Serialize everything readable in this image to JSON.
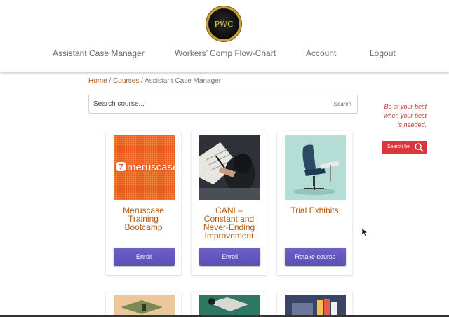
{
  "header": {
    "logo_text": "PWC",
    "nav": [
      "Assistant Case Manager",
      "Workers’ Comp Flow-Chart",
      "Account",
      "Logout"
    ]
  },
  "breadcrumb": {
    "home": "Home",
    "sep1": " / ",
    "courses": "Courses",
    "sep2": " / ",
    "current": "Assistant Case Manager"
  },
  "search": {
    "placeholder": "Search course...",
    "button": "Search"
  },
  "sidebar": {
    "tagline": [
      "Be at your best",
      "when your best",
      "is needed."
    ],
    "search_label": "Search he",
    "accent": "#d9363e"
  },
  "courses": [
    {
      "title": [
        "Meruscase",
        "Training",
        "Bootcamp"
      ],
      "action": "Enroll",
      "logo_text": "meruscase"
    },
    {
      "title": [
        "CANI –",
        "Constant and",
        "Never-Ending",
        "Improvement"
      ],
      "action": "Enroll"
    },
    {
      "title": [
        "Trial Exhibits"
      ],
      "action": "Retake course"
    }
  ],
  "colors": {
    "link": "#b25a14",
    "button": "#5a4eb7"
  }
}
